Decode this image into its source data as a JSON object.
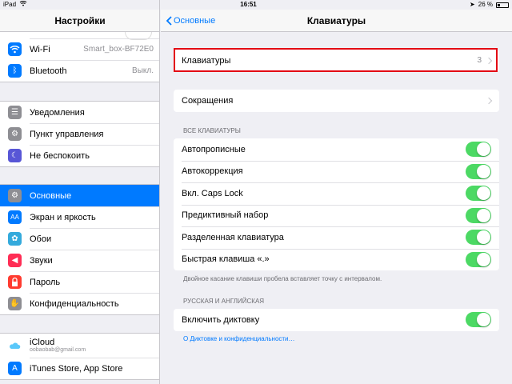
{
  "status": {
    "device": "iPad",
    "time": "16:51",
    "battery": "26 %"
  },
  "sidebar": {
    "title": "Настройки",
    "group1": [
      {
        "label": "Wi-Fi",
        "value": "Smart_box-BF72E0",
        "icon": "wifi-icon",
        "color": "#007aff"
      },
      {
        "label": "Bluetooth",
        "value": "Выкл.",
        "icon": "bluetooth-icon",
        "color": "#007aff"
      }
    ],
    "group2": [
      {
        "label": "Уведомления",
        "icon": "notifications-icon",
        "color": "#8e8e93"
      },
      {
        "label": "Пункт управления",
        "icon": "control-center-icon",
        "color": "#8e8e93"
      },
      {
        "label": "Не беспокоить",
        "icon": "moon-icon",
        "color": "#5856d6"
      }
    ],
    "group3": [
      {
        "label": "Основные",
        "icon": "gear-icon",
        "color": "#8e8e93"
      },
      {
        "label": "Экран и яркость",
        "icon": "brightness-icon",
        "color": "#007aff"
      },
      {
        "label": "Обои",
        "icon": "wallpaper-icon",
        "color": "#34aadc"
      },
      {
        "label": "Звуки",
        "icon": "sounds-icon",
        "color": "#ff2d55"
      },
      {
        "label": "Пароль",
        "icon": "lock-icon",
        "color": "#ff3b30"
      },
      {
        "label": "Конфиденциальность",
        "icon": "hand-icon",
        "color": "#8e8e93"
      }
    ],
    "group4": [
      {
        "label": "iCloud",
        "sub": "oobaobab@gmail.com",
        "icon": "icloud-icon",
        "color": "#ffffff"
      },
      {
        "label": "iTunes Store, App Store",
        "icon": "app-store-icon",
        "color": "#007aff"
      }
    ]
  },
  "main": {
    "back_label": "Основные",
    "title": "Клавиатуры",
    "keyboards": {
      "label": "Клавиатуры",
      "count": "3"
    },
    "shortcuts": {
      "label": "Сокращения"
    },
    "all_keyboards_header": "ВСЕ КЛАВИАТУРЫ",
    "toggles": [
      {
        "label": "Автопрописные",
        "on": true
      },
      {
        "label": "Автокоррекция",
        "on": true
      },
      {
        "label": "Вкл. Caps Lock",
        "on": true
      },
      {
        "label": "Предиктивный набор",
        "on": true
      },
      {
        "label": "Разделенная клавиатура",
        "on": true
      },
      {
        "label": "Быстрая клавиша «.»",
        "on": true
      }
    ],
    "toggles_footer": "Двойное касание клавиши пробела вставляет точку с интервалом.",
    "ru_en_header": "РУССКАЯ И АНГЛИЙСКАЯ",
    "dictation": {
      "label": "Включить диктовку",
      "on": true
    },
    "dictation_link": "О Диктовке и конфиденциальности…"
  }
}
